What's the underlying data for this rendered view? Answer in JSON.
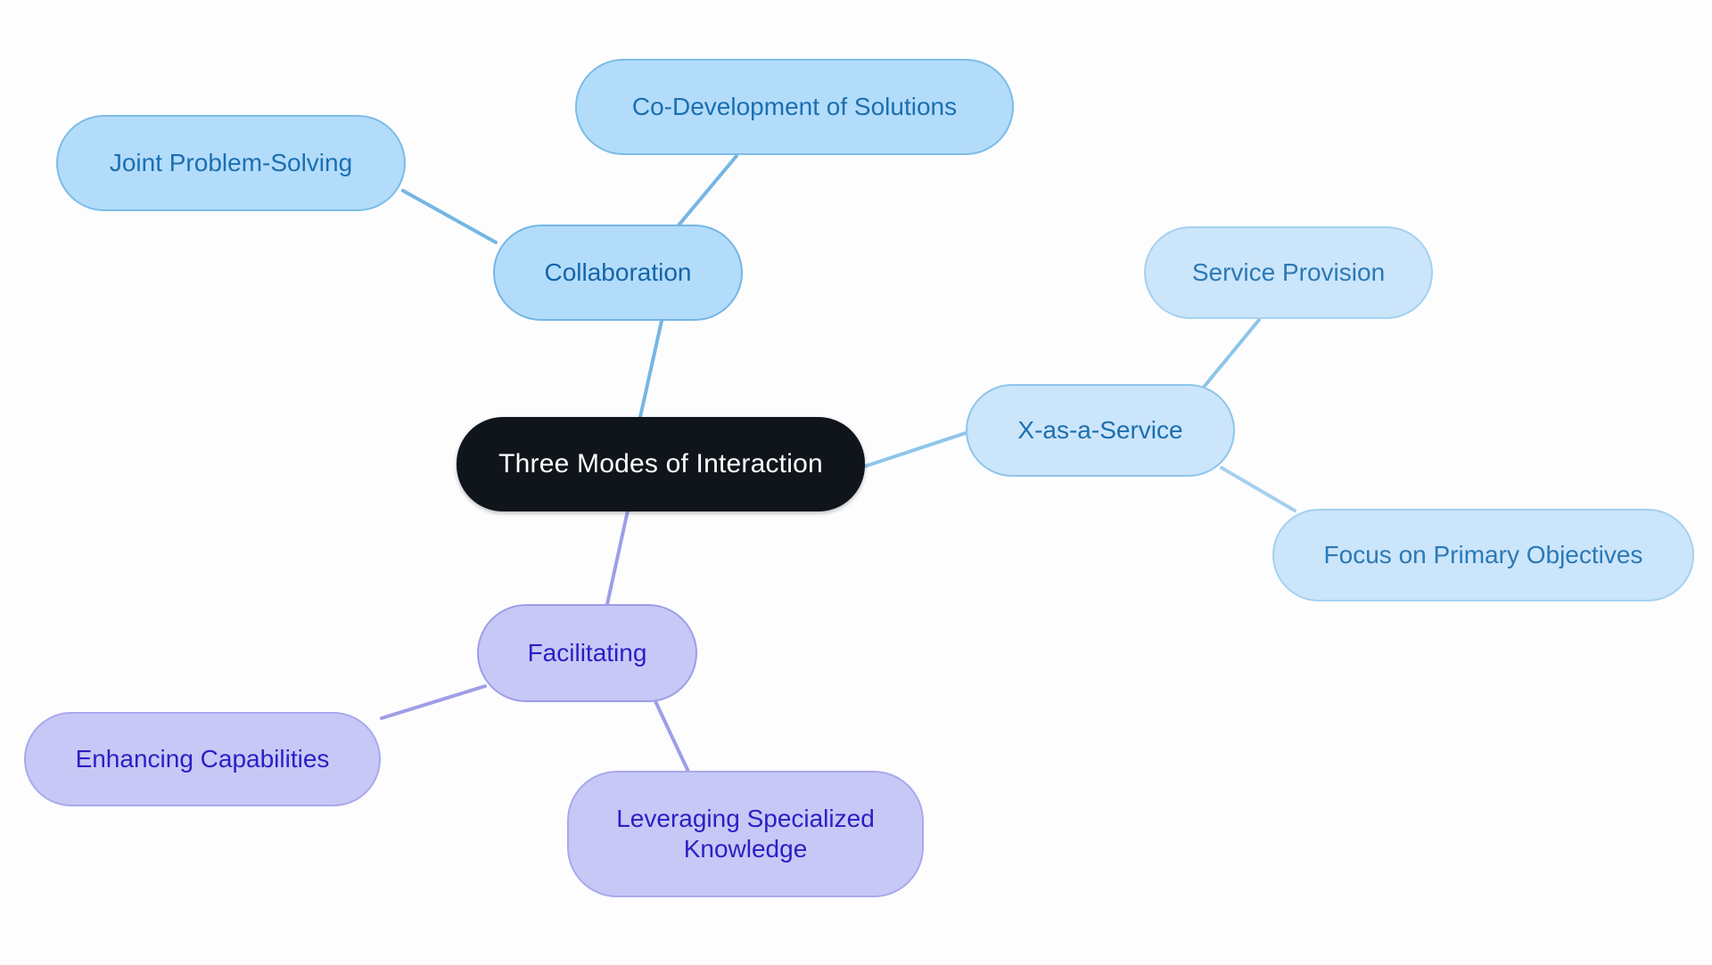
{
  "diagram": {
    "type": "mindmap",
    "title": "Three Modes of Interaction",
    "background_color": "#fdfdfe"
  },
  "colors": {
    "root_fill": "#10151c",
    "root_text": "#ffffff",
    "blue_fill": "#b3dcfb",
    "blue_border": "#74b6e4",
    "blue_text": "#1565a8",
    "pale_blue_fill": "#cbe5fb",
    "pale_blue_border": "#8ec5ea",
    "pale_blue_text": "#1d6fae",
    "purple_fill": "#c8c8f7",
    "purple_border": "#9e9ee8",
    "purple_text": "#2a1fc4",
    "edge_blue": "#74b6e4",
    "edge_pale_blue": "#8ec5ea",
    "edge_purple": "#9e9ee8"
  },
  "nodes": {
    "root": {
      "label": "Three Modes of Interaction"
    },
    "collaboration": {
      "label": "Collaboration"
    },
    "joint_problem_solving": {
      "label": "Joint Problem-Solving"
    },
    "co_development": {
      "label": "Co-Development of Solutions"
    },
    "xaas": {
      "label": "X-as-a-Service"
    },
    "service_provision": {
      "label": "Service Provision"
    },
    "focus_primary_objectives": {
      "label": "Focus on Primary Objectives"
    },
    "facilitating": {
      "label": "Facilitating"
    },
    "enhancing_capabilities": {
      "label": "Enhancing Capabilities"
    },
    "leveraging_knowledge": {
      "label": "Leveraging Specialized\nKnowledge"
    }
  },
  "edges": [
    {
      "from": "root",
      "to": "collaboration",
      "color": "#74b6e4"
    },
    {
      "from": "collaboration",
      "to": "joint_problem_solving",
      "color": "#74b6e4"
    },
    {
      "from": "collaboration",
      "to": "co_development",
      "color": "#74b6e4"
    },
    {
      "from": "root",
      "to": "xaas",
      "color": "#8ec5ea"
    },
    {
      "from": "xaas",
      "to": "service_provision",
      "color": "#8ec5ea"
    },
    {
      "from": "xaas",
      "to": "focus_primary_objectives",
      "color": "#a5d1ef"
    },
    {
      "from": "root",
      "to": "facilitating",
      "color": "#9e9ee8"
    },
    {
      "from": "facilitating",
      "to": "enhancing_capabilities",
      "color": "#9e9ee8"
    },
    {
      "from": "facilitating",
      "to": "leveraging_knowledge",
      "color": "#9e9ee8"
    }
  ]
}
